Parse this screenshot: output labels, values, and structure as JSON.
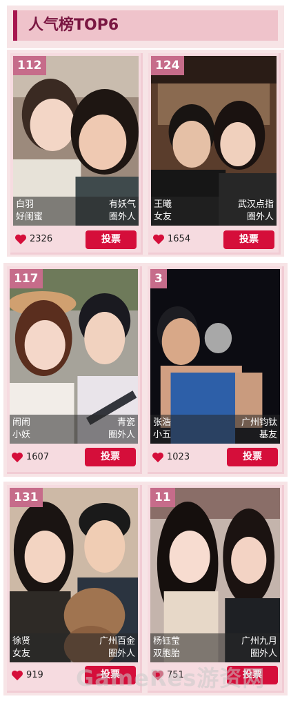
{
  "header": {
    "title": "人气榜TOP6"
  },
  "vote_label": "投票",
  "accent_color": "#d50e3a",
  "badge_color": "#c66c8a",
  "cards": [
    {
      "rank_votes": "112",
      "name_left": "白羽",
      "tag_left": "好闺蜜",
      "name_right": "有妖气",
      "tag_right": "圈外人",
      "likes": "2326"
    },
    {
      "rank_votes": "124",
      "name_left": "王曦",
      "tag_left": "女友",
      "name_right": "武汉点指",
      "tag_right": "圈外人",
      "likes": "1654"
    },
    {
      "rank_votes": "117",
      "name_left": "闹闹",
      "tag_left": "小妖",
      "name_right": "青瓷",
      "tag_right": "圈外人",
      "likes": "1607"
    },
    {
      "rank_votes": "3",
      "name_left": "张浩",
      "tag_left": "小五",
      "name_right": "广州钧钛",
      "tag_right": "基友",
      "likes": "1023"
    },
    {
      "rank_votes": "131",
      "name_left": "徐贤",
      "tag_left": "女友",
      "name_right": "广州百金",
      "tag_right": "圈外人",
      "likes": "919"
    },
    {
      "rank_votes": "11",
      "name_left": "杨钰莹",
      "tag_left": "双胞胎",
      "name_right": "广州九月",
      "tag_right": "圈外人",
      "likes": "751"
    }
  ],
  "watermark": "GameRes游资网"
}
